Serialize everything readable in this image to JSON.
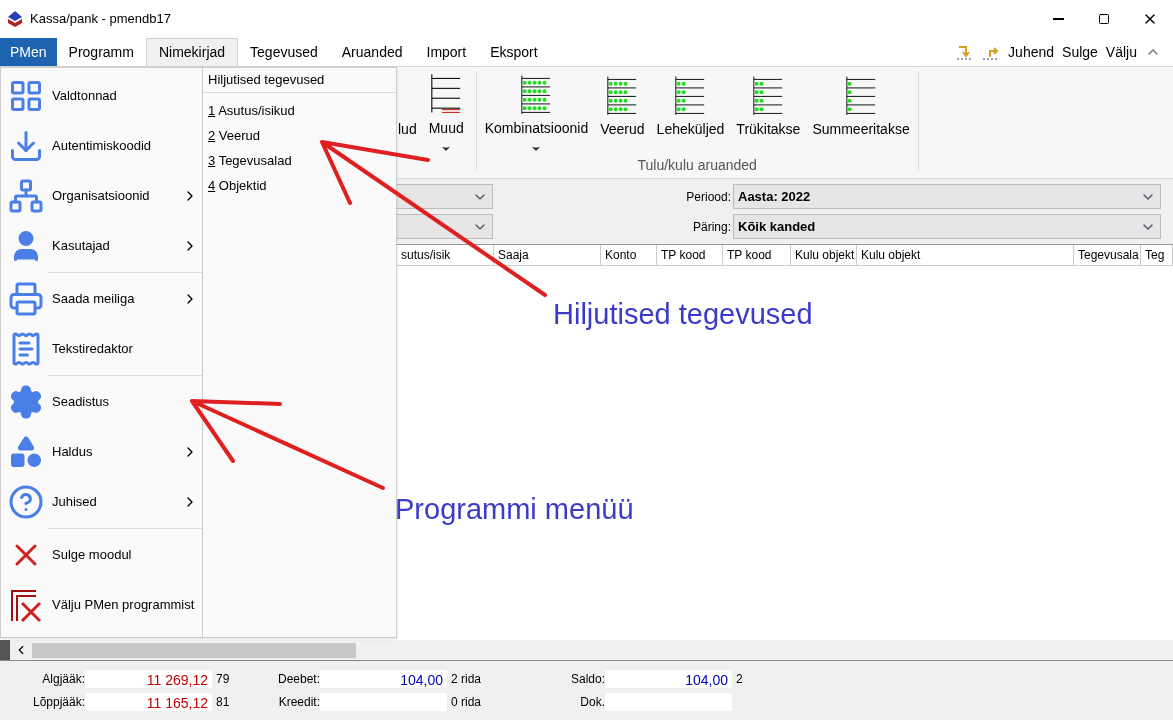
{
  "window": {
    "title": "Kassa/pank - pmendb17"
  },
  "menubar": [
    {
      "label": "PMen",
      "kind": "app",
      "selected": false
    },
    {
      "label": "Programm",
      "kind": "menu",
      "selected": false
    },
    {
      "label": "Nimekirjad",
      "kind": "menu",
      "selected": true
    },
    {
      "label": "Tegevused",
      "kind": "menu",
      "selected": false
    },
    {
      "label": "Aruanded",
      "kind": "menu",
      "selected": false
    },
    {
      "label": "Import",
      "kind": "menu",
      "selected": false
    },
    {
      "label": "Eksport",
      "kind": "menu",
      "selected": false
    }
  ],
  "quick_actions": [
    "Juhend",
    "Sulge",
    "Välju"
  ],
  "ribbon": {
    "buttons": [
      {
        "label": "lud",
        "dropdown": false
      },
      {
        "label": "Muud",
        "dropdown": true
      },
      {
        "label": "Kombinatsioonid",
        "dropdown": true
      },
      {
        "label": "Veerud",
        "dropdown": false
      },
      {
        "label": "Leheküljed",
        "dropdown": false
      },
      {
        "label": "Trükitakse",
        "dropdown": false
      },
      {
        "label": "Summeeritakse",
        "dropdown": false
      }
    ],
    "group_label": "Tulu/kulu aruanded"
  },
  "filters": [
    {
      "label": "Periood:",
      "value": "Aasta: 2022"
    },
    {
      "label": "Päring:",
      "value": "Kõik kanded"
    }
  ],
  "table": {
    "columns": [
      "sutus/isik",
      "Saaja",
      "Konto",
      "TP kood",
      "TP kood",
      "Kulu objekt",
      "Kulu objekt",
      "Tegevusala",
      "Teg"
    ]
  },
  "footer": [
    {
      "label": "Algjääk:",
      "value": "11 269,12",
      "color": "#c00000",
      "note": "79"
    },
    {
      "label": "Deebet:",
      "value": "104,00",
      "color": "#0000c0",
      "note": "2 rida"
    },
    {
      "label": "Saldo:",
      "value": "104,00",
      "color": "#0000c0",
      "note": "2"
    },
    {
      "label": "Lõppjääk:",
      "value": "11 165,12",
      "color": "#c00000",
      "note": "81"
    },
    {
      "label": "Kreedit:",
      "note": "0 rida"
    },
    {
      "label": "Dok."
    }
  ],
  "app_menu": {
    "items": [
      {
        "label": "Valdtonnad",
        "submenu": false,
        "separator_before": false
      },
      {
        "label": "Autentimiskoodid",
        "submenu": false,
        "separator_before": false
      },
      {
        "label": "Organisatsioonid",
        "submenu": true,
        "separator_before": false
      },
      {
        "label": "Kasutajad",
        "submenu": true,
        "separator_before": false
      },
      {
        "label": "Saada meiliga",
        "submenu": true,
        "separator_before": true
      },
      {
        "label": "Tekstiredaktor",
        "submenu": false,
        "separator_before": false
      },
      {
        "label": "Seadistus",
        "submenu": false,
        "separator_before": true
      },
      {
        "label": "Haldus",
        "submenu": true,
        "separator_before": false
      },
      {
        "label": "Juhised",
        "submenu": true,
        "separator_before": false
      },
      {
        "label": "Sulge moodul",
        "submenu": false,
        "separator_before": true
      },
      {
        "label": "Välju PMen programmist",
        "submenu": false,
        "separator_before": false
      }
    ],
    "recent": {
      "title": "Hiljutised tegevused",
      "items": [
        {
          "number": "1",
          "label": "Asutus/isikud"
        },
        {
          "number": "2",
          "label": "Veerud"
        },
        {
          "number": "3",
          "label": "Tegevusalad"
        },
        {
          "number": "4",
          "label": "Objektid"
        }
      ]
    }
  },
  "annotations": [
    "Hiljutised tegevused",
    "Programmi menüü"
  ]
}
